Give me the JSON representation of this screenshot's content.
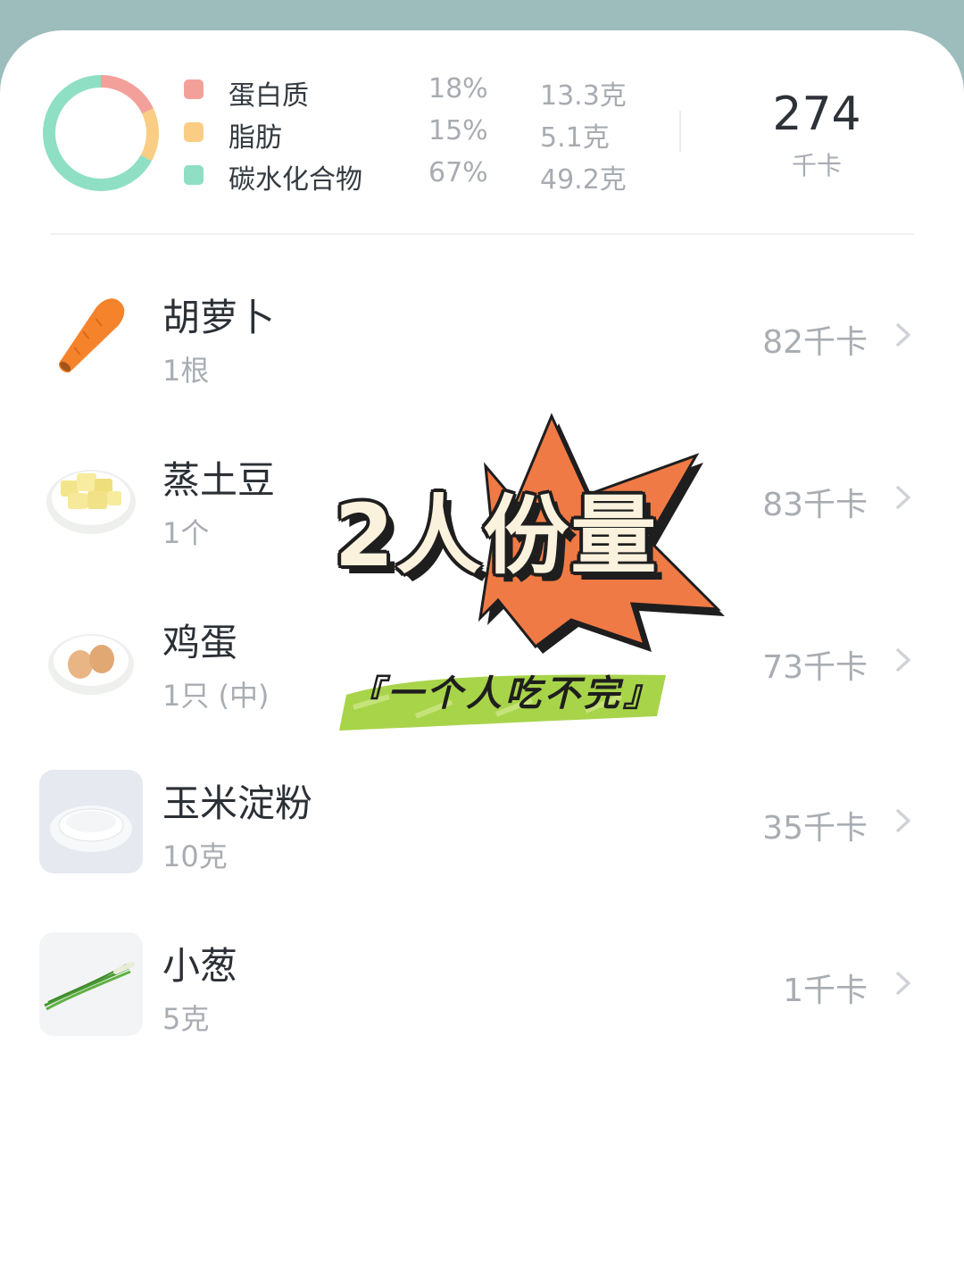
{
  "summary": {
    "macros": [
      {
        "name": "蛋白质",
        "percent": "18%",
        "grams": "13.3克",
        "color": "#f4a09a",
        "fraction": 0.18
      },
      {
        "name": "脂肪",
        "percent": "15%",
        "grams": "5.1克",
        "color": "#f9cd84",
        "fraction": 0.15
      },
      {
        "name": "碳水化合物",
        "percent": "67%",
        "grams": "49.2克",
        "color": "#8edfc3",
        "fraction": 0.67
      }
    ],
    "total_kcal": "274",
    "total_unit": "千卡"
  },
  "ingredients": [
    {
      "name": "胡萝卜",
      "qty": "1根",
      "kcal": "82千卡",
      "icon": "carrot-icon"
    },
    {
      "name": "蒸土豆",
      "qty": "1个",
      "kcal": "83千卡",
      "icon": "potato-icon"
    },
    {
      "name": "鸡蛋",
      "qty": "1只 (中)",
      "kcal": "73千卡",
      "icon": "egg-icon"
    },
    {
      "name": "玉米淀粉",
      "qty": "10克",
      "kcal": "35千卡",
      "icon": "starch-icon"
    },
    {
      "name": "小葱",
      "qty": "5克",
      "kcal": "1千卡",
      "icon": "scallion-icon"
    }
  ],
  "sticker": {
    "title": "2人份量",
    "subtitle": "一个人吃不完",
    "bracket_left": "『",
    "bracket_right": "』",
    "colors": {
      "star": "#f07a45",
      "brush": "#a8d44a",
      "text": "#fbf2de"
    }
  }
}
